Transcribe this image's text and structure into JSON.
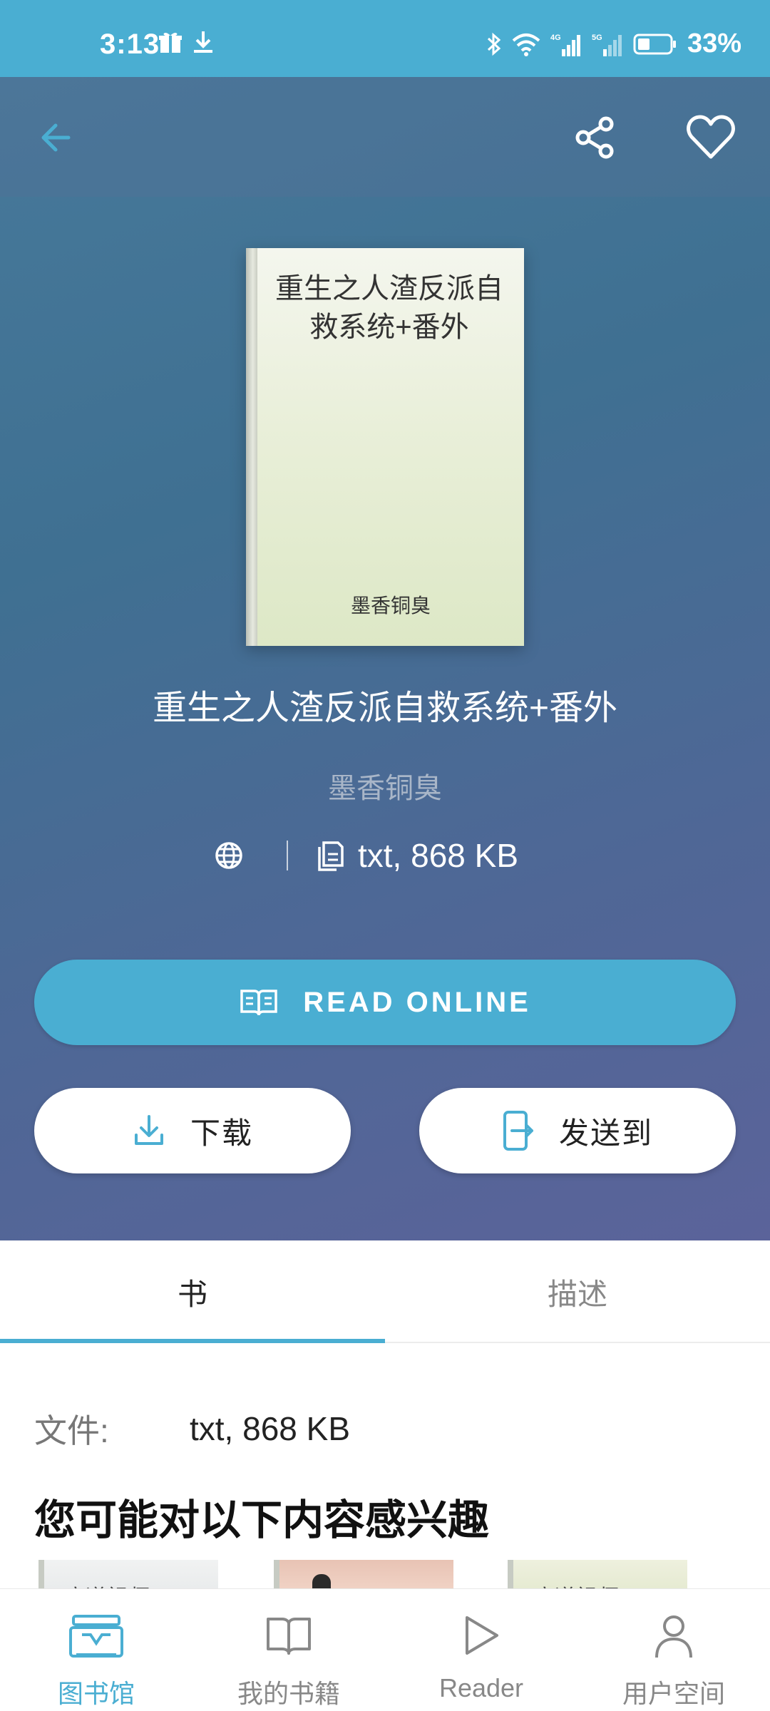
{
  "status_bar": {
    "time": "3:13",
    "battery": "33%",
    "net_left": "4G",
    "net_right": "5G"
  },
  "book": {
    "cover_title": "重生之人渣反派自救系统+番外",
    "cover_author": "墨香铜臭",
    "title": "重生之人渣反派自救系统+番外",
    "author": "墨香铜臭",
    "format_size": "txt, 868 KB"
  },
  "actions": {
    "read_online": "READ ONLINE",
    "download": "下载",
    "send_to": "发送到"
  },
  "tabs": [
    {
      "label": "书"
    },
    {
      "label": "描述"
    }
  ],
  "details": {
    "file_label": "文件:",
    "file_value": "txt, 868 KB"
  },
  "suggestions": {
    "title": "您可能对以下内容感兴趣",
    "items": [
      {
        "label": "魔道祖师 (Mo"
      },
      {
        "label": ""
      },
      {
        "label": "魔道祖师"
      }
    ]
  },
  "bottom_nav": [
    {
      "label": "图书馆"
    },
    {
      "label": "我的书籍"
    },
    {
      "label": "Reader"
    },
    {
      "label": "用户空间"
    }
  ],
  "colors": {
    "accent": "#4aaed2",
    "hero_gradient_start": "#47799a",
    "hero_gradient_end": "#5b639a"
  }
}
